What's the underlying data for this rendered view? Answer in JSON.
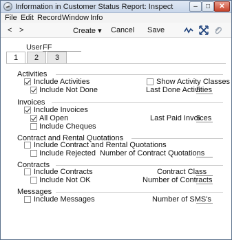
{
  "window": {
    "title": "Information in Customer Status Report: Inspect"
  },
  "menu": [
    "File",
    "Edit",
    "Record",
    "Window",
    "Info"
  ],
  "toolbar": {
    "prev": "<",
    "next": ">",
    "create": "Create ▾",
    "cancel": "Cancel",
    "save": "Save"
  },
  "user": {
    "label": "User",
    "value": "FF"
  },
  "tabs": [
    "1",
    "2",
    "3"
  ],
  "activities": {
    "heading": "Activities",
    "include_activities": {
      "label": "Include Activities",
      "checked": true
    },
    "include_not_done": {
      "label": "Include Not Done",
      "checked": true
    },
    "show_activity_classes": {
      "label": "Show Activity Classes",
      "checked": false
    },
    "last_done_label": "Last Done Activities",
    "last_done_value": "5"
  },
  "invoices": {
    "heading": "Invoices",
    "include_invoices": {
      "label": "Include Invoices",
      "checked": true
    },
    "all_open": {
      "label": "All Open",
      "checked": true
    },
    "include_cheques": {
      "label": "Include Cheques",
      "checked": false
    },
    "last_paid_label": "Last Paid Invoices",
    "last_paid_value": "5"
  },
  "contract_quotations": {
    "heading": "Contract and Rental Quotations",
    "include": {
      "label": "Include Contract and Rental Quotations",
      "checked": false
    },
    "include_rejected": {
      "label": "Include Rejected",
      "checked": false
    },
    "number_label": "Number of Contract Quotations",
    "number_value": ""
  },
  "contracts": {
    "heading": "Contracts",
    "include": {
      "label": "Include Contracts",
      "checked": false
    },
    "include_not_ok": {
      "label": "Include Not OK",
      "checked": false
    },
    "class_label": "Contract Class",
    "class_value": "",
    "number_label": "Number of Contracts",
    "number_value": ""
  },
  "messages": {
    "heading": "Messages",
    "include": {
      "label": "Include Messages",
      "checked": false
    },
    "number_label": "Number of SMS's",
    "number_value": ""
  }
}
